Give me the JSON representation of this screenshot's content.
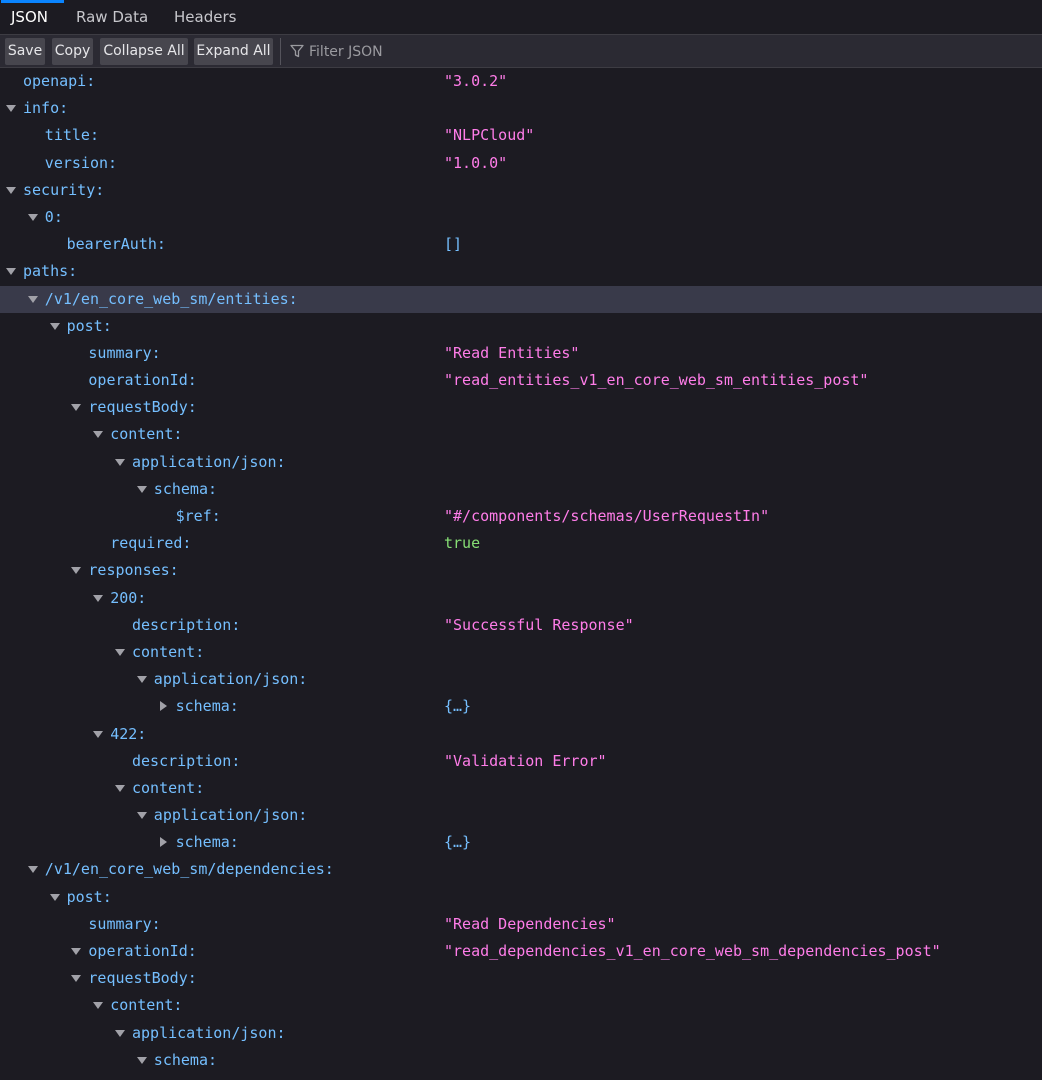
{
  "tabs": [
    {
      "label": "JSON",
      "selected": true
    },
    {
      "label": "Raw Data",
      "selected": false
    },
    {
      "label": "Headers",
      "selected": false
    }
  ],
  "toolbar": {
    "save_label": "Save",
    "copy_label": "Copy",
    "collapse_label": "Collapse All",
    "expand_label": "Expand All",
    "filter_placeholder": "Filter JSON",
    "filter_icon": "funnel-icon"
  },
  "colors": {
    "key": "#75bfff",
    "string": "#ff7de9",
    "boolean": "#86de74",
    "selected_row": "#393a4a",
    "tab_underline": "#0a84ff"
  },
  "rows": [
    {
      "key": "openapi:",
      "value": "\"3.0.2\"",
      "type": "str",
      "depth": 0
    },
    {
      "key": "info:",
      "depth": 0,
      "toggle": "open"
    },
    {
      "key": "title:",
      "value": "\"NLPCloud\"",
      "type": "str",
      "depth": 1
    },
    {
      "key": "version:",
      "value": "\"1.0.0\"",
      "type": "str",
      "depth": 1
    },
    {
      "key": "security:",
      "depth": 0,
      "toggle": "open"
    },
    {
      "key": "0:",
      "depth": 1,
      "toggle": "open"
    },
    {
      "key": "bearerAuth:",
      "value": "[]",
      "type": "obj",
      "depth": 2
    },
    {
      "key": "paths:",
      "depth": 0,
      "toggle": "open"
    },
    {
      "key": "/v1/en_core_web_sm/entities:",
      "depth": 1,
      "toggle": "open",
      "selected": true
    },
    {
      "key": "post:",
      "depth": 2,
      "toggle": "open"
    },
    {
      "key": "summary:",
      "value": "\"Read Entities\"",
      "type": "str",
      "depth": 3
    },
    {
      "key": "operationId:",
      "value": "\"read_entities_v1_en_core_web_sm_entities_post\"",
      "type": "str",
      "depth": 3
    },
    {
      "key": "requestBody:",
      "depth": 3,
      "toggle": "open"
    },
    {
      "key": "content:",
      "depth": 4,
      "toggle": "open"
    },
    {
      "key": "application/json:",
      "depth": 5,
      "toggle": "open"
    },
    {
      "key": "schema:",
      "depth": 6,
      "toggle": "open"
    },
    {
      "key": "$ref:",
      "value": "\"#/components/schemas/UserRequestIn\"",
      "type": "str",
      "depth": 7
    },
    {
      "key": "required:",
      "value": "true",
      "type": "bool",
      "depth": 4
    },
    {
      "key": "responses:",
      "depth": 3,
      "toggle": "open"
    },
    {
      "key": "200:",
      "depth": 4,
      "toggle": "open"
    },
    {
      "key": "description:",
      "value": "\"Successful Response\"",
      "type": "str",
      "depth": 5
    },
    {
      "key": "content:",
      "depth": 5,
      "toggle": "open"
    },
    {
      "key": "application/json:",
      "depth": 6,
      "toggle": "open"
    },
    {
      "key": "schema:",
      "value": "{…}",
      "type": "obj",
      "depth": 7,
      "toggle": "closed"
    },
    {
      "key": "422:",
      "depth": 4,
      "toggle": "open"
    },
    {
      "key": "description:",
      "value": "\"Validation Error\"",
      "type": "str",
      "depth": 5
    },
    {
      "key": "content:",
      "depth": 5,
      "toggle": "open"
    },
    {
      "key": "application/json:",
      "depth": 6,
      "toggle": "open"
    },
    {
      "key": "schema:",
      "value": "{…}",
      "type": "obj",
      "depth": 7,
      "toggle": "closed"
    },
    {
      "key": "/v1/en_core_web_sm/dependencies:",
      "depth": 1,
      "toggle": "open"
    },
    {
      "key": "post:",
      "depth": 2,
      "toggle": "open"
    },
    {
      "key": "summary:",
      "value": "\"Read Dependencies\"",
      "type": "str",
      "depth": 3
    },
    {
      "key": "operationId:",
      "value": "\"read_dependencies_v1_en_core_web_sm_dependencies_post\"",
      "type": "str",
      "depth": 3,
      "toggle": "open"
    },
    {
      "key": "requestBody:",
      "depth": 3,
      "toggle": "open"
    },
    {
      "key": "content:",
      "depth": 4,
      "toggle": "open"
    },
    {
      "key": "application/json:",
      "depth": 5,
      "toggle": "open"
    },
    {
      "key": "schema:",
      "depth": 6,
      "toggle": "open"
    }
  ]
}
